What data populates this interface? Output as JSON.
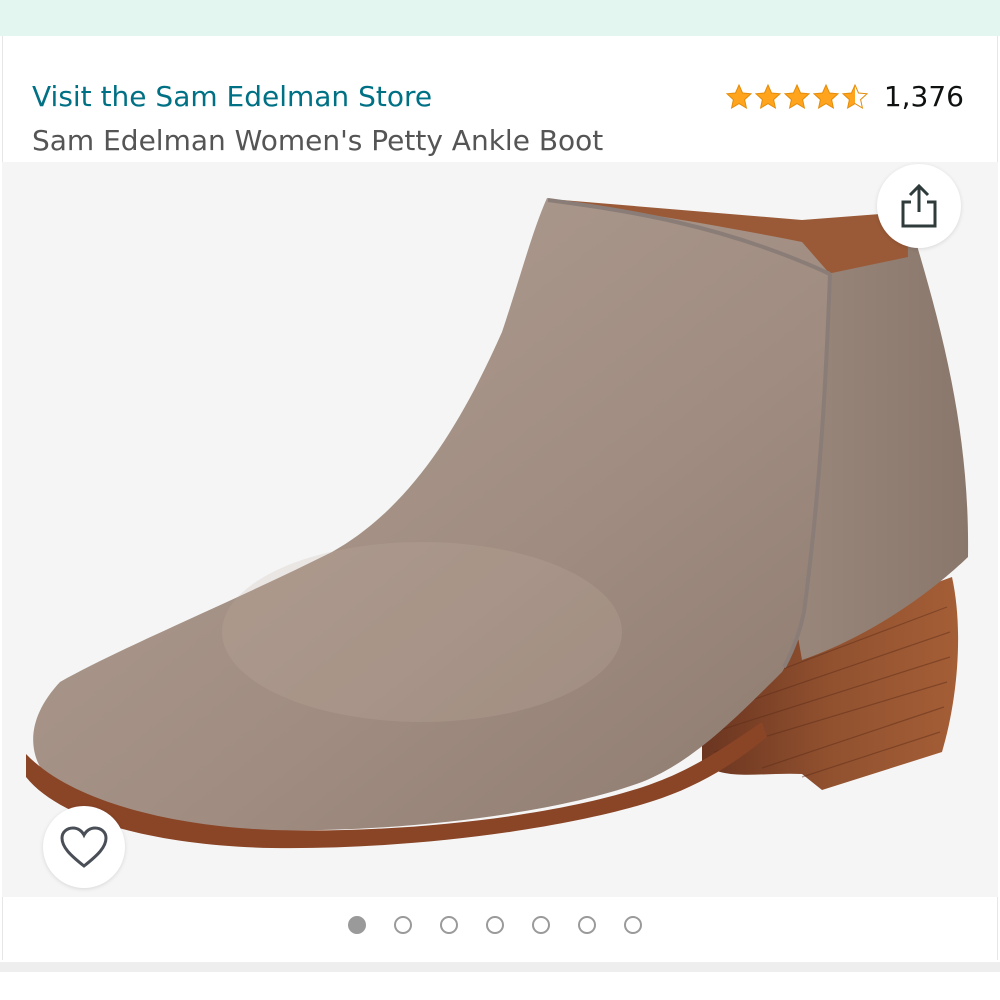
{
  "store": {
    "link_text": "Visit the Sam Edelman Store"
  },
  "product": {
    "title": "Sam Edelman Women's Petty Ankle Boot"
  },
  "rating": {
    "stars": 4.5,
    "max_stars": 5,
    "count_text": "1,376",
    "star_color": "#ffa41c"
  },
  "gallery": {
    "image_count": 7,
    "active_index": 0
  },
  "icons": {
    "share": "share-icon",
    "wishlist": "heart-outline-icon"
  },
  "colors": {
    "link": "#007185",
    "banner": "#e3f6f0",
    "suede": "#a38f84",
    "heel": "#8c4a2c"
  }
}
